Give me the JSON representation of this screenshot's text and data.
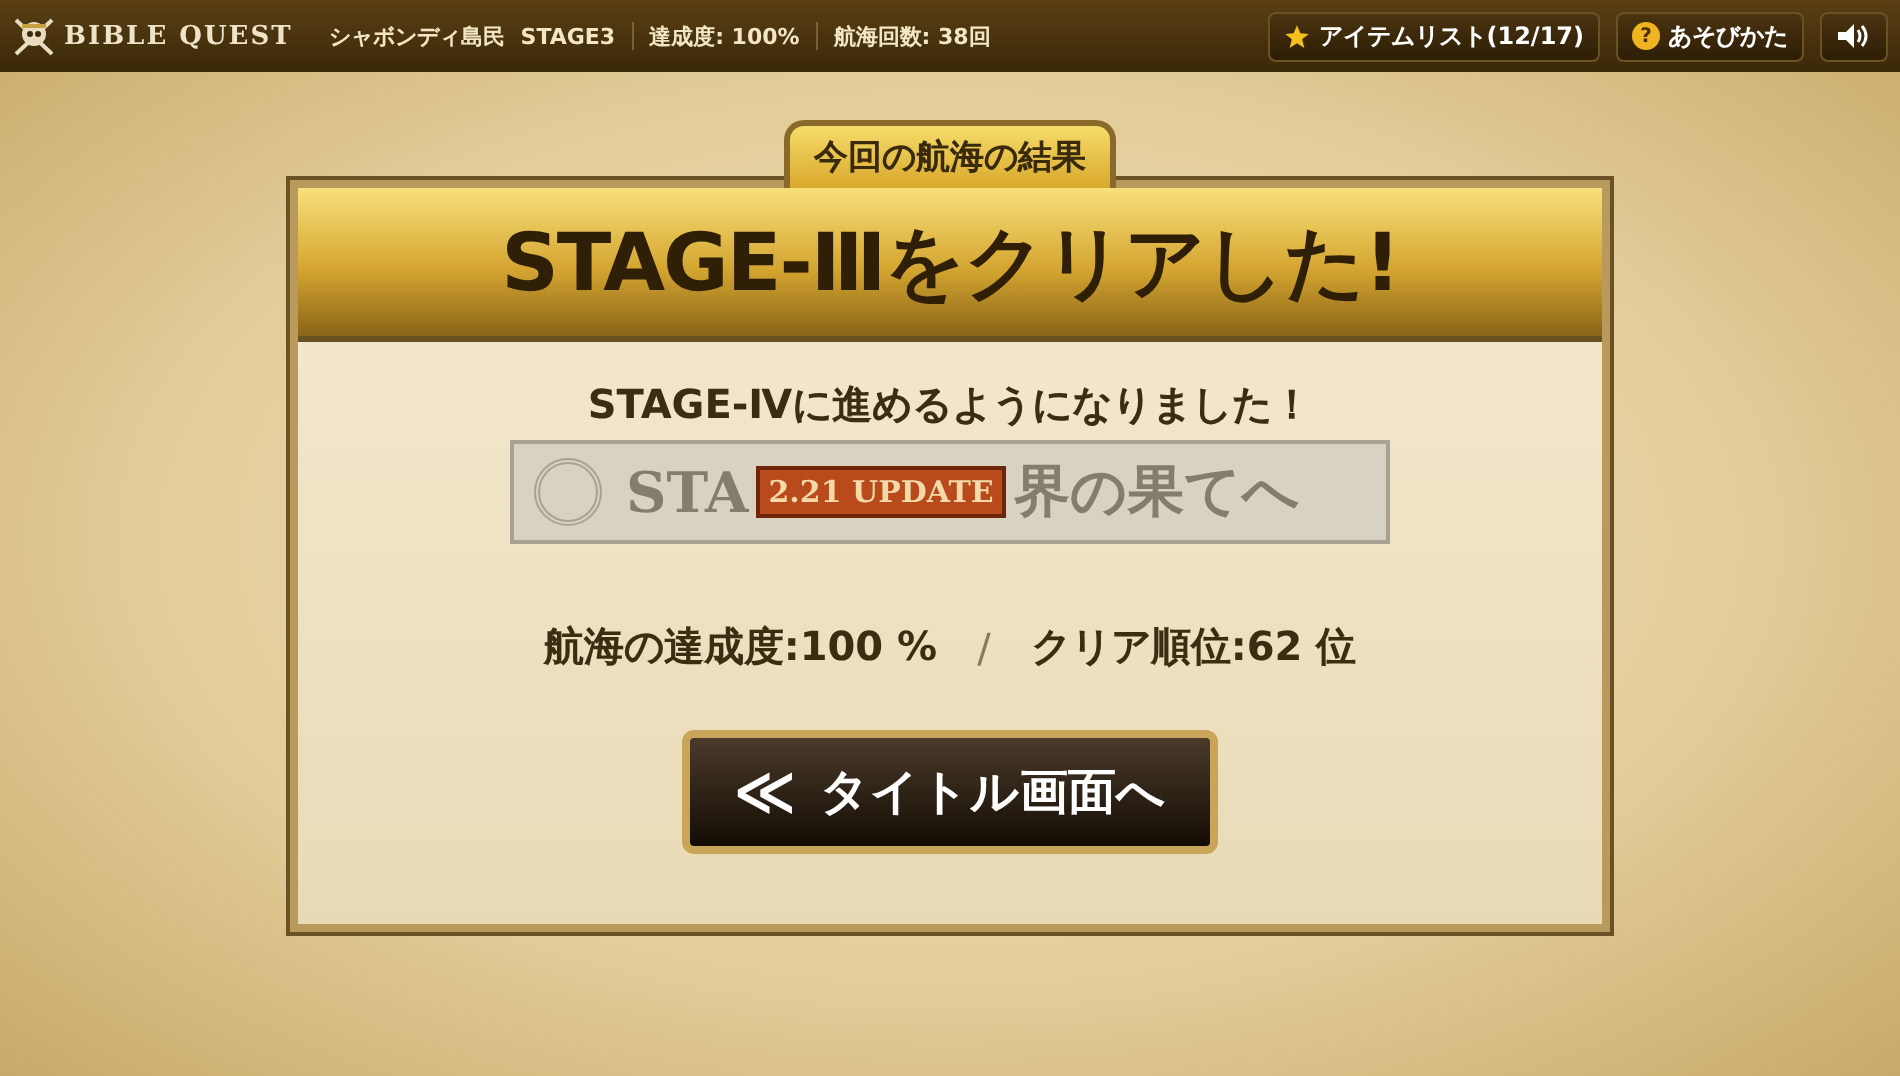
{
  "top_bar": {
    "logo": "BIBLE QUEST",
    "location": "シャボンディ島民",
    "stage": "STAGE3",
    "completion": "達成度: 100%",
    "voyages": "航海回数: 38回",
    "item_list_button": "アイテムリスト(12/17)",
    "help_icon": "?",
    "help_button": "あそびかた"
  },
  "result": {
    "tab": "今回の航海の結果",
    "title": "STAGE-Ⅲをクリアした!",
    "message": "STAGE-Ⅳに進めるようになりました！",
    "banner_left": "STA",
    "banner_stamp": "2.21 UPDATE",
    "banner_right": "界の果てへ",
    "completion": "航海の達成度:100 %",
    "separator": "/",
    "rank": "クリア順位:62 位",
    "title_button_icon": "≪",
    "title_button": "タイトル画面へ"
  }
}
